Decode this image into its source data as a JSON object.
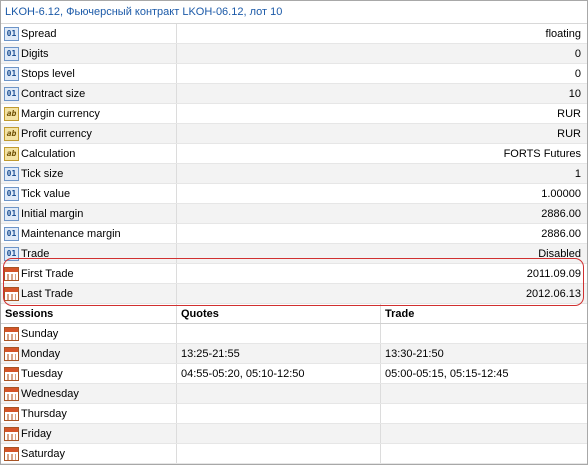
{
  "title": "LKOH-6.12, Фьючерсный контракт LKOH-06.12, лот 10",
  "properties": [
    {
      "icon": "numeric-icon",
      "icon_text": "01",
      "name": "Spread",
      "value": "floating"
    },
    {
      "icon": "numeric-icon",
      "icon_text": "01",
      "name": "Digits",
      "value": "0"
    },
    {
      "icon": "numeric-icon",
      "icon_text": "01",
      "name": "Stops level",
      "value": "0"
    },
    {
      "icon": "numeric-icon",
      "icon_text": "01",
      "name": "Contract size",
      "value": "10"
    },
    {
      "icon": "text-icon",
      "icon_text": "ab",
      "name": "Margin currency",
      "value": "RUR"
    },
    {
      "icon": "text-icon",
      "icon_text": "ab",
      "name": "Profit currency",
      "value": "RUR"
    },
    {
      "icon": "text-icon",
      "icon_text": "ab",
      "name": "Calculation",
      "value": "FORTS Futures"
    },
    {
      "icon": "numeric-icon",
      "icon_text": "01",
      "name": "Tick size",
      "value": "1"
    },
    {
      "icon": "numeric-icon",
      "icon_text": "01",
      "name": "Tick value",
      "value": "1.00000"
    },
    {
      "icon": "numeric-icon",
      "icon_text": "01",
      "name": "Initial margin",
      "value": "2886.00"
    },
    {
      "icon": "numeric-icon",
      "icon_text": "01",
      "name": "Maintenance margin",
      "value": "2886.00"
    },
    {
      "icon": "numeric-icon",
      "icon_text": "01",
      "name": "Trade",
      "value": "Disabled"
    },
    {
      "icon": "calendar-icon",
      "icon_text": "",
      "name": "First Trade",
      "value": "2011.09.09"
    },
    {
      "icon": "calendar-icon",
      "icon_text": "",
      "name": "Last Trade",
      "value": "2012.06.13"
    }
  ],
  "sessions": {
    "header": {
      "day": "Sessions",
      "quotes": "Quotes",
      "trade": "Trade"
    },
    "rows": [
      {
        "day": "Sunday",
        "quotes": "",
        "trade": ""
      },
      {
        "day": "Monday",
        "quotes": "13:25-21:55",
        "trade": "13:30-21:50"
      },
      {
        "day": "Tuesday",
        "quotes": "04:55-05:20, 05:10-12:50",
        "trade": "05:00-05:15, 05:15-12:45"
      },
      {
        "day": "Wednesday",
        "quotes": "",
        "trade": ""
      },
      {
        "day": "Thursday",
        "quotes": "",
        "trade": ""
      },
      {
        "day": "Friday",
        "quotes": "",
        "trade": ""
      },
      {
        "day": "Saturday",
        "quotes": "",
        "trade": ""
      }
    ]
  }
}
